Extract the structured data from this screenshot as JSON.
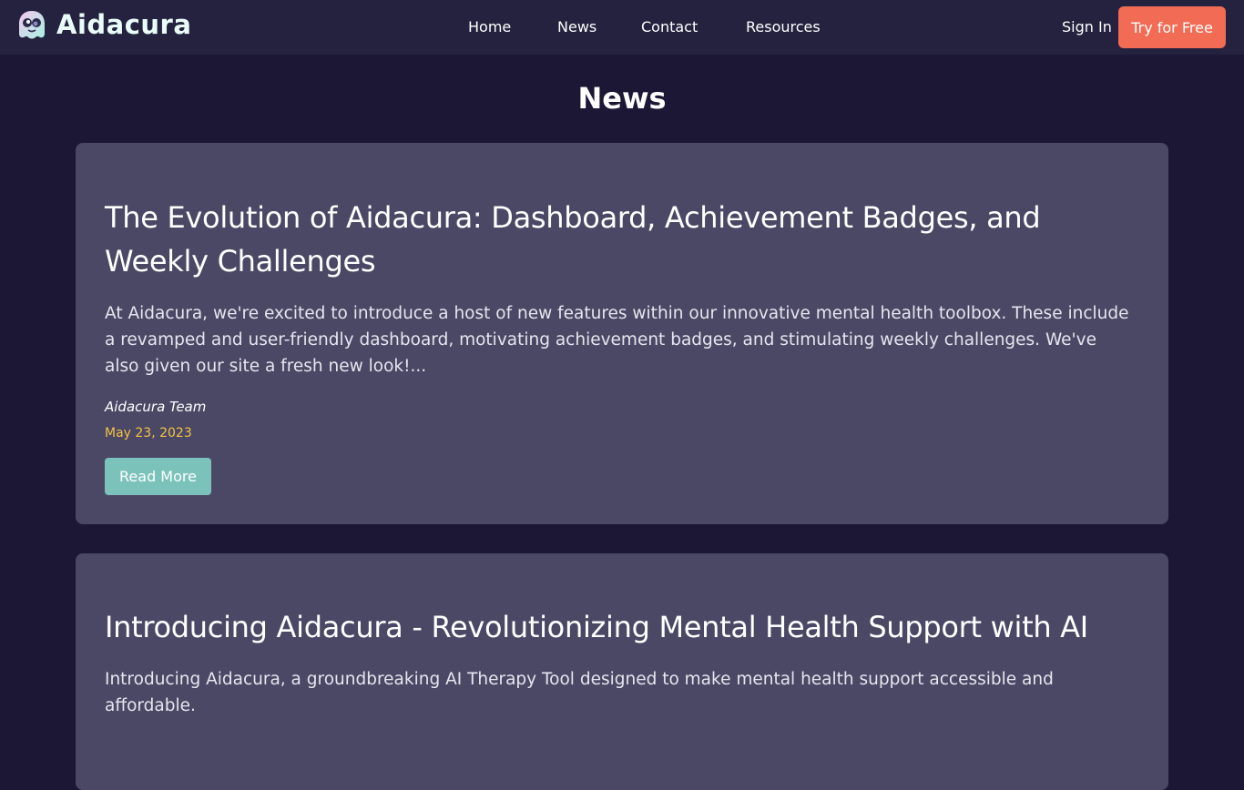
{
  "header": {
    "brand_name": "Aidacura",
    "logo_icon": "aidacura-ghost-logo",
    "nav": [
      {
        "label": "Home"
      },
      {
        "label": "News"
      },
      {
        "label": "Contact"
      },
      {
        "label": "Resources"
      }
    ],
    "sign_in_label": "Sign In",
    "cta_label": "Try for Free"
  },
  "page": {
    "title": "News"
  },
  "articles": [
    {
      "title": "The Evolution of Aidacura: Dashboard, Achievement Badges, and Weekly Challenges",
      "excerpt": "At Aidacura, we're excited to introduce a host of new features within our innovative mental health toolbox. These include a revamped and user-friendly dashboard, motivating achievement badges, and stimulating weekly challenges. We've also given our site a fresh new look!...",
      "author": "Aidacura Team",
      "date": "May 23, 2023",
      "read_more_label": "Read More"
    },
    {
      "title": "Introducing Aidacura - Revolutionizing Mental Health Support with AI",
      "excerpt": "Introducing Aidacura, a groundbreaking AI Therapy Tool designed to make mental health support accessible and affordable."
    }
  ],
  "colors": {
    "background": "#1b1734",
    "navbar": "#25223f",
    "card": "#4b4866",
    "cta": "#f26c55",
    "read_more": "#7bc2bb",
    "date": "#f5c242"
  }
}
